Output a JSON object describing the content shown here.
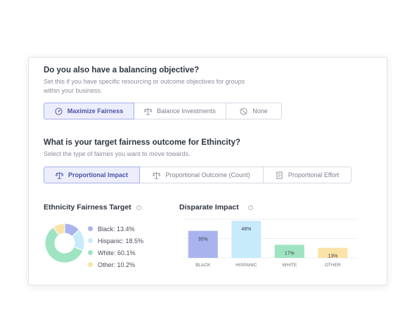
{
  "balancing": {
    "title": "Do you also have a balancing objective?",
    "subtitle": "Set this if you have specific resourcing or outcome objectives for groups within your business.",
    "options": [
      {
        "label": "Maximize Fairness",
        "icon": "gauge-icon",
        "active": true
      },
      {
        "label": "Balance Investments",
        "icon": "scale-icon",
        "active": false
      },
      {
        "label": "None",
        "icon": "none-icon",
        "active": false
      }
    ]
  },
  "target": {
    "title": "What is your target fairness outcome for Ethincity?",
    "subtitle": "Select the type of fairnes you want to move towards.",
    "options": [
      {
        "label": "Proportional Impact",
        "icon": "scale-icon",
        "active": true
      },
      {
        "label": "Proportional Outcome (Count)",
        "icon": "scale-icon",
        "active": false
      },
      {
        "label": "Proportional Effort",
        "icon": "document-icon",
        "active": false
      }
    ]
  },
  "fairness_target": {
    "title": "Ethnicity Fairness Target",
    "legend": [
      {
        "label": "Black: 13.4%",
        "color": "#a9b4ef"
      },
      {
        "label": "Hispanic: 18.5%",
        "color": "#c8ebfb"
      },
      {
        "label": "White: 60.1%",
        "color": "#9fe4c2"
      },
      {
        "label": "Other: 10.2%",
        "color": "#fbe3a8"
      }
    ]
  },
  "disparate_impact": {
    "title": "Disparate Impact"
  },
  "chart_data": [
    {
      "type": "pie",
      "title": "Ethnicity Fairness Target",
      "categories": [
        "Black",
        "Hispanic",
        "White",
        "Other"
      ],
      "values": [
        13.4,
        18.5,
        60.1,
        10.2
      ],
      "colors": [
        "#a9b4ef",
        "#c8ebfb",
        "#9fe4c2",
        "#fbe3a8"
      ]
    },
    {
      "type": "bar",
      "title": "Disparate Impact",
      "categories": [
        "BLACK",
        "HISPANIC",
        "WHITE",
        "OTHER"
      ],
      "values": [
        35,
        48,
        17,
        13
      ],
      "value_labels": [
        "35%",
        "48%",
        "17%",
        "13%"
      ],
      "colors": [
        "#a9b4ef",
        "#c8ebfb",
        "#9fe4c2",
        "#fbe3a8"
      ],
      "ylim": [
        0,
        50
      ],
      "grid": true
    }
  ]
}
